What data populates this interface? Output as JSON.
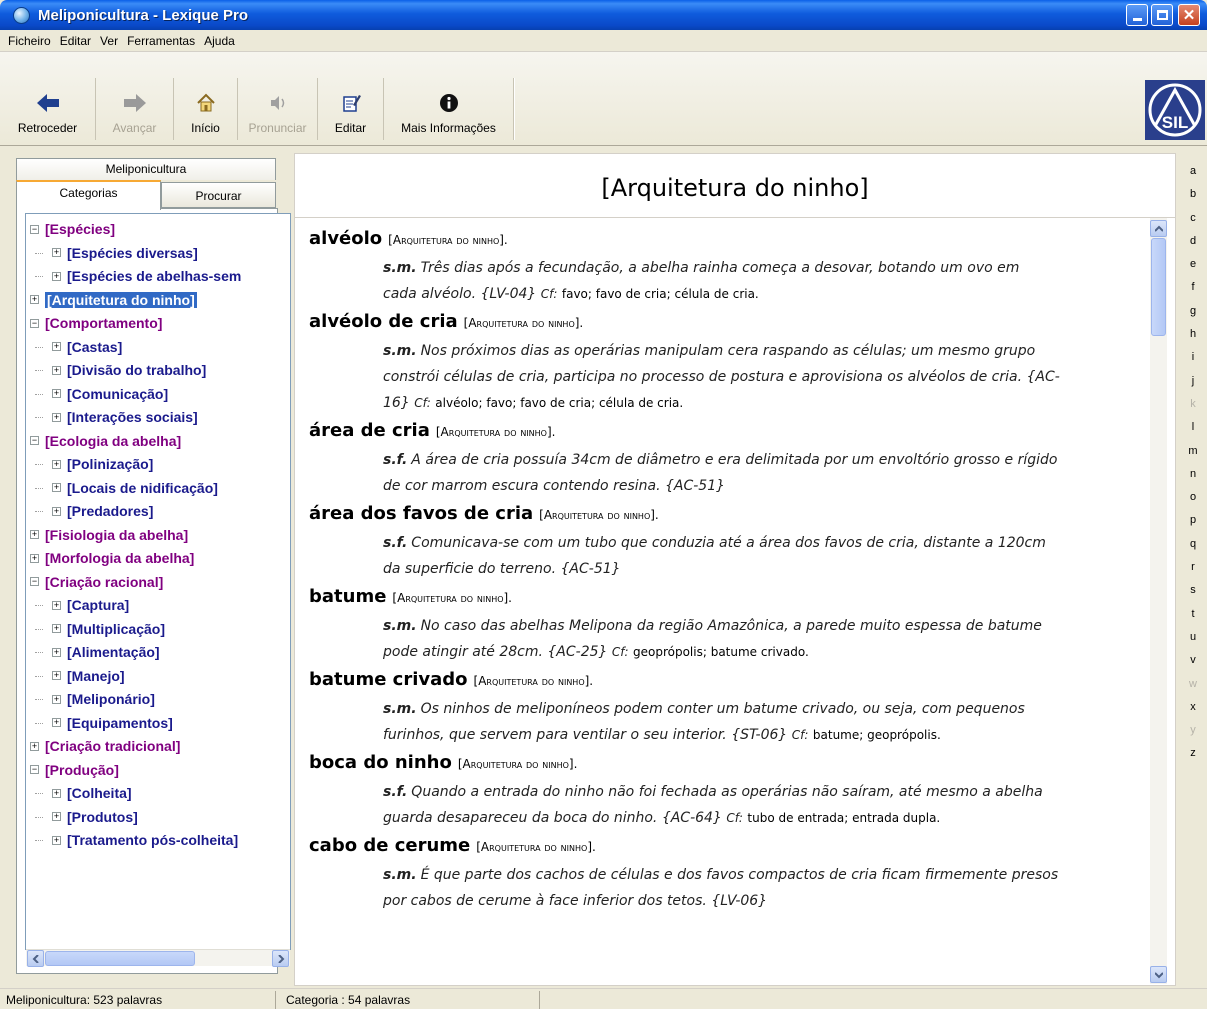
{
  "window": {
    "title": "Meliponicultura - Lexique Pro"
  },
  "menu": [
    "Ficheiro",
    "Editar",
    "Ver",
    "Ferramentas",
    "Ajuda"
  ],
  "toolbar": {
    "back": "Retroceder",
    "forward": "Avançar",
    "home": "Início",
    "pronounce": "Pronunciar",
    "edit": "Editar",
    "info": "Mais Informações",
    "logo": "SIL"
  },
  "left": {
    "main_tab": "Meliponicultura",
    "tab_categories": "Categorias",
    "tab_search": "Procurar",
    "tree": [
      {
        "label": "[Espécies]",
        "level": 0,
        "expanded": true
      },
      {
        "label": "[Espécies diversas]",
        "level": 1
      },
      {
        "label": "[Espécies de abelhas-sem",
        "level": 1
      },
      {
        "label": "[Arquitetura do ninho]",
        "level": 0,
        "selected": true
      },
      {
        "label": "[Comportamento]",
        "level": 0,
        "expanded": true
      },
      {
        "label": "[Castas]",
        "level": 1
      },
      {
        "label": "[Divisão do trabalho]",
        "level": 1
      },
      {
        "label": "[Comunicação]",
        "level": 1
      },
      {
        "label": "[Interações sociais]",
        "level": 1
      },
      {
        "label": "[Ecologia da abelha]",
        "level": 0,
        "expanded": true
      },
      {
        "label": "[Polinização]",
        "level": 1
      },
      {
        "label": "[Locais de nidificação]",
        "level": 1
      },
      {
        "label": "[Predadores]",
        "level": 1
      },
      {
        "label": "[Fisiologia da abelha]",
        "level": 0
      },
      {
        "label": "[Morfologia da abelha]",
        "level": 0
      },
      {
        "label": "[Criação racional]",
        "level": 0,
        "expanded": true
      },
      {
        "label": "[Captura]",
        "level": 1
      },
      {
        "label": "[Multiplicação]",
        "level": 1
      },
      {
        "label": "[Alimentação]",
        "level": 1
      },
      {
        "label": "[Manejo]",
        "level": 1
      },
      {
        "label": "[Meliponário]",
        "level": 1
      },
      {
        "label": "[Equipamentos]",
        "level": 1
      },
      {
        "label": "[Criação tradicional]",
        "level": 0
      },
      {
        "label": "[Produção]",
        "level": 0,
        "expanded": true
      },
      {
        "label": "[Colheita]",
        "level": 1
      },
      {
        "label": "[Produtos]",
        "level": 1
      },
      {
        "label": "[Tratamento pós-colheita]",
        "level": 1
      }
    ]
  },
  "content": {
    "title": "[Arquitetura do ninho]",
    "entries": [
      {
        "headword": "alvéolo",
        "category": "[Arquitetura do ninho].",
        "pos": "s.m.",
        "lines": [
          "Três dias após a fecundação, a abelha rainha começa a desovar, botando um ovo em",
          "cada alvéolo. {LV-04}"
        ],
        "cf": "Cf:",
        "cf_words": "favo; favo de cria; célula de cria."
      },
      {
        "headword": "alvéolo de cria",
        "category": "[Arquitetura do ninho].",
        "pos": "s.m.",
        "lines": [
          "Nos próximos dias as operárias manipulam cera raspando as células; um mesmo grupo",
          "constrói células de cria, participa no processo de postura e aprovisiona os alvéolos de cria. {AC-",
          "16}"
        ],
        "cf": "Cf:",
        "cf_words": "alvéolo; favo; favo de cria; célula de cria."
      },
      {
        "headword": "área de cria",
        "category": "[Arquitetura do ninho].",
        "pos": "s.f.",
        "lines": [
          "A área de cria possuía 34cm de diâmetro e era delimitada por um envoltório grosso e rígido",
          "de cor marrom escura contendo resina. {AC-51}"
        ],
        "cf": "",
        "cf_words": ""
      },
      {
        "headword": "área dos favos de cria",
        "category": "[Arquitetura do ninho].",
        "pos": "s.f.",
        "lines": [
          "Comunicava-se com um tubo que conduzia até a área dos favos de cria, distante a 120cm",
          "da superficie do terreno. {AC-51}"
        ],
        "cf": "",
        "cf_words": ""
      },
      {
        "headword": "batume",
        "category": "[Arquitetura do ninho].",
        "pos": "s.m.",
        "lines": [
          "No caso das abelhas Melipona da região Amazônica, a parede muito espessa de batume",
          "pode atingir até 28cm. {AC-25}"
        ],
        "cf": "Cf:",
        "cf_words": "geoprópolis; batume crivado."
      },
      {
        "headword": "batume crivado",
        "category": "[Arquitetura do ninho].",
        "pos": "s.m.",
        "lines": [
          "Os ninhos de meliponíneos podem conter um batume crivado, ou seja, com pequenos",
          "furinhos, que servem para ventilar o seu interior. {ST-06}"
        ],
        "cf": "Cf:",
        "cf_words": "batume; geoprópolis."
      },
      {
        "headword": "boca do ninho",
        "category": "[Arquitetura do ninho].",
        "pos": "s.f.",
        "lines": [
          "Quando a entrada do ninho não foi fechada as operárias não saíram, até mesmo a abelha",
          "guarda desapareceu da boca do ninho. {AC-64}"
        ],
        "cf": "Cf:",
        "cf_words": "tubo de entrada; entrada dupla."
      },
      {
        "headword": "cabo de cerume",
        "category": "[Arquitetura do ninho].",
        "pos": "s.m.",
        "lines": [
          "É que parte dos cachos de células e dos favos compactos de cria ficam firmemente presos",
          "por cabos de cerume à face inferior dos tetos. {LV-06}"
        ],
        "cf": "",
        "cf_words": ""
      }
    ]
  },
  "alphabet": [
    {
      "l": "a",
      "on": true
    },
    {
      "l": "b",
      "on": true
    },
    {
      "l": "c",
      "on": true
    },
    {
      "l": "d",
      "on": true
    },
    {
      "l": "e",
      "on": true
    },
    {
      "l": "f",
      "on": true
    },
    {
      "l": "g",
      "on": true
    },
    {
      "l": "h",
      "on": true
    },
    {
      "l": "i",
      "on": true
    },
    {
      "l": "j",
      "on": true
    },
    {
      "l": "k",
      "on": false
    },
    {
      "l": "l",
      "on": true
    },
    {
      "l": "m",
      "on": true
    },
    {
      "l": "n",
      "on": true
    },
    {
      "l": "o",
      "on": true
    },
    {
      "l": "p",
      "on": true
    },
    {
      "l": "q",
      "on": true
    },
    {
      "l": "r",
      "on": true
    },
    {
      "l": "s",
      "on": true
    },
    {
      "l": "t",
      "on": true
    },
    {
      "l": "u",
      "on": true
    },
    {
      "l": "v",
      "on": true
    },
    {
      "l": "w",
      "on": false
    },
    {
      "l": "x",
      "on": true
    },
    {
      "l": "y",
      "on": false
    },
    {
      "l": "z",
      "on": true
    }
  ],
  "status": {
    "left": "Meliponicultura: 523 palavras",
    "right": "Categoria : 54 palavras"
  },
  "colors": {
    "title_bar": "#0A5FE8",
    "category_purple": "#800080",
    "subcategory_blue": "#1A1A8C",
    "selection": "#316AC5",
    "logo_bg": "#2A3F8C"
  },
  "icons": [
    "app-icon",
    "back-arrow-icon",
    "forward-arrow-icon",
    "home-icon",
    "speaker-icon",
    "edit-icon",
    "info-icon",
    "sil-logo-icon"
  ]
}
